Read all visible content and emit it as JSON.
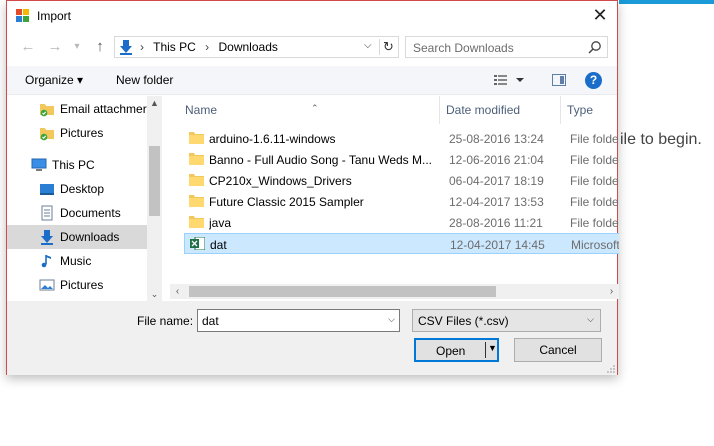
{
  "background_app": {
    "instruction_text": "ile to begin."
  },
  "dialog": {
    "title": "Import",
    "close_glyph": "✕"
  },
  "address_bar": {
    "crumbs": [
      "This PC",
      "Downloads"
    ],
    "separator": "›"
  },
  "search": {
    "placeholder": "Search Downloads"
  },
  "toolbar": {
    "organize_label": "Organize ▾",
    "new_folder_label": "New folder",
    "help_glyph": "?"
  },
  "nav_pane": {
    "items": [
      {
        "label": "Email attachmer",
        "icon": "folder-check-icon"
      },
      {
        "label": "Pictures",
        "icon": "folder-check-icon"
      },
      {
        "label": "This PC",
        "icon": "computer-icon"
      },
      {
        "label": "Desktop",
        "icon": "desktop-icon"
      },
      {
        "label": "Documents",
        "icon": "documents-icon"
      },
      {
        "label": "Downloads",
        "icon": "download-arrow-icon",
        "selected": true
      },
      {
        "label": "Music",
        "icon": "music-note-icon"
      },
      {
        "label": "Pictures",
        "icon": "pictures-icon"
      }
    ]
  },
  "file_list": {
    "columns": [
      "Name",
      "Date modified",
      "Type"
    ],
    "rows": [
      {
        "name": "arduino-1.6.11-windows",
        "date": "25-08-2016 13:24",
        "type": "File folder",
        "icon": "folder-icon"
      },
      {
        "name": "Banno - Full Audio Song - Tanu Weds M...",
        "date": "12-06-2016 21:04",
        "type": "File folder",
        "icon": "folder-icon"
      },
      {
        "name": "CP210x_Windows_Drivers",
        "date": "06-04-2017 18:19",
        "type": "File folder",
        "icon": "folder-icon"
      },
      {
        "name": "Future Classic 2015 Sampler",
        "date": "12-04-2017 13:53",
        "type": "File folder",
        "icon": "folder-icon"
      },
      {
        "name": "java",
        "date": "28-08-2016 11:21",
        "type": "File folder",
        "icon": "folder-icon"
      },
      {
        "name": "dat",
        "date": "12-04-2017 14:45",
        "type": "Microsoft",
        "icon": "excel-file-icon",
        "selected": true
      }
    ]
  },
  "bottom": {
    "file_name_label": "File name:",
    "file_name_value": "dat",
    "file_type_value": "CSV Files (*.csv)",
    "open_label": "Open",
    "cancel_label": "Cancel"
  },
  "colors": {
    "accent": "#0078d7",
    "selection": "#cce8ff",
    "folder": "#f2c75c",
    "excel": "#1e7145"
  }
}
